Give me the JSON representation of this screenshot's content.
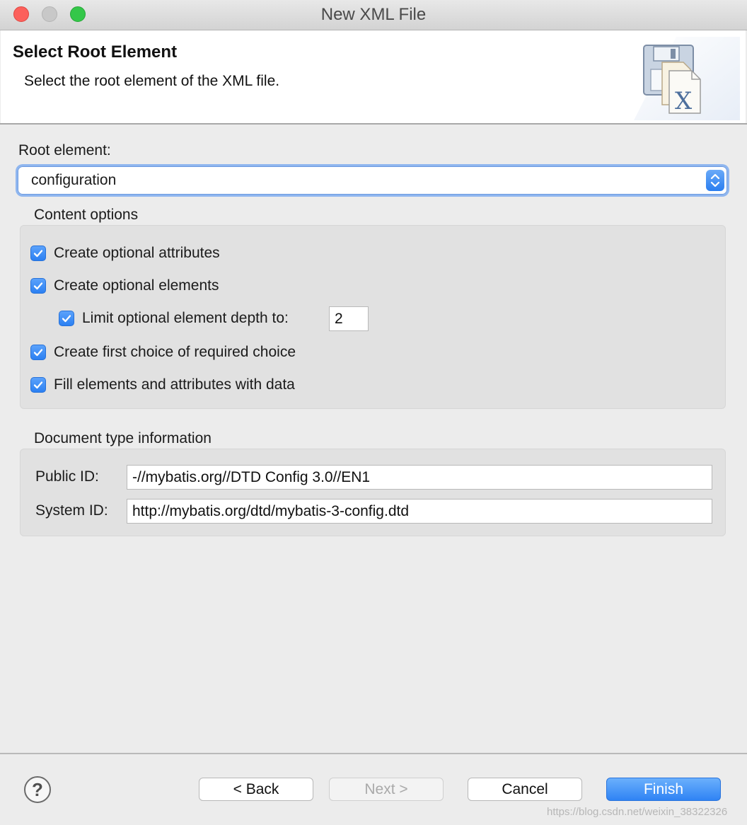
{
  "window": {
    "title": "New XML File"
  },
  "header": {
    "title": "Select Root Element",
    "description": "Select the root element of the XML file."
  },
  "root_element": {
    "label": "Root element:",
    "selected": "configuration"
  },
  "content_options": {
    "legend": "Content options",
    "create_optional_attributes": {
      "label": "Create optional attributes",
      "checked": true
    },
    "create_optional_elements": {
      "label": "Create optional elements",
      "checked": true
    },
    "limit_depth": {
      "label": "Limit optional element depth to:",
      "checked": true,
      "value": "2"
    },
    "create_first_choice": {
      "label": "Create first choice of required choice",
      "checked": true
    },
    "fill_with_data": {
      "label": "Fill elements and attributes with data",
      "checked": true
    }
  },
  "doctype": {
    "legend": "Document type information",
    "public_id_label": "Public ID:",
    "public_id": "-//mybatis.org//DTD Config 3.0//EN1",
    "system_id_label": "System ID:",
    "system_id": "http://mybatis.org/dtd/mybatis-3-config.dtd"
  },
  "buttons": {
    "help": "?",
    "back": "< Back",
    "next": "Next >",
    "cancel": "Cancel",
    "finish": "Finish"
  },
  "watermark": "https://blog.csdn.net/weixin_38322326",
  "colors": {
    "accent": "#2f83f4",
    "panel": "#e1e1e1",
    "window": "#ececec"
  },
  "icons": {
    "wizard_graphic": "xml-file-wizard-icon",
    "checkbox": "checkmark-icon",
    "select": "chevron-up-down-icon"
  }
}
